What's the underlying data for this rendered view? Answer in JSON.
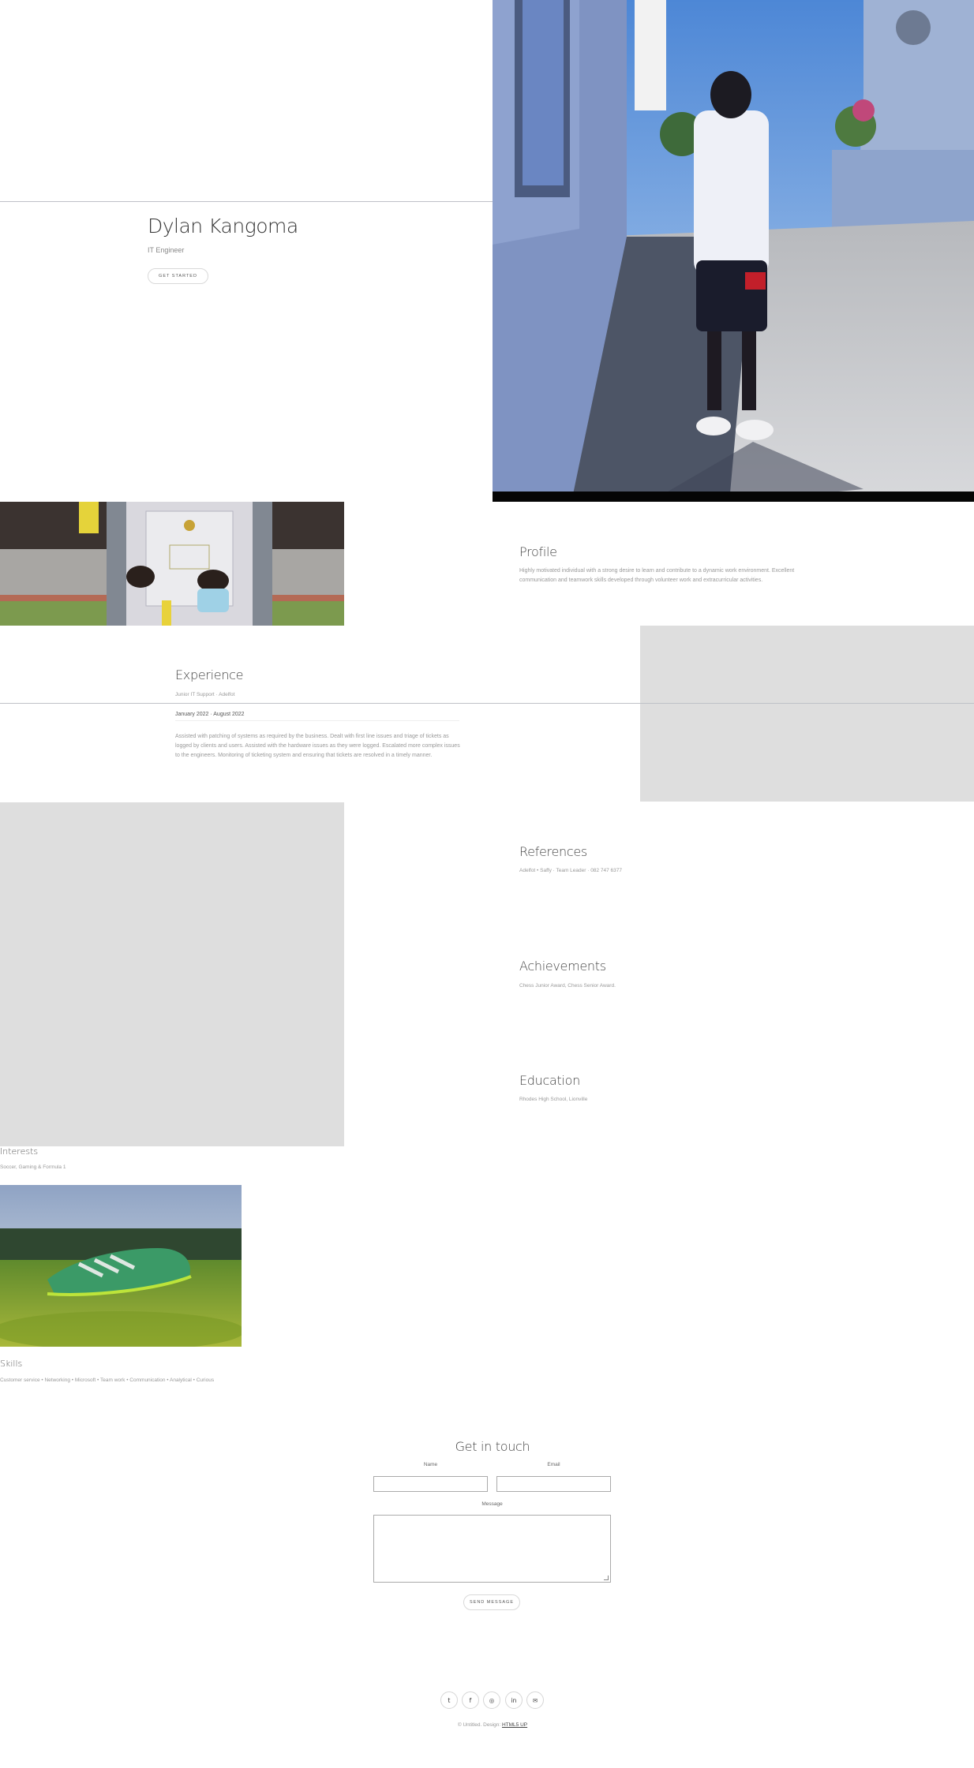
{
  "hero": {
    "name": "Dylan Kangoma",
    "role": "IT Engineer",
    "cta": "GET STARTED"
  },
  "profile": {
    "title": "Profile",
    "text": "Highly motivated individual with a strong desire to learn and contribute to a dynamic work environment. Excellent communication and teamwork skills developed through volunteer work and extracurricular activities."
  },
  "experience": {
    "title": "Experience",
    "role": "Junior IT Support · Adelfot",
    "dates": "January 2022 · August 2022",
    "text": "Assisted with patching of systems as required by the business. Dealt with first line issues and triage of tickets as logged by clients and users. Assisted with the hardware issues as they were logged. Escalated more complex issues to the engineers. Monitoring of ticketing system and ensuring that tickets are resolved in a timely manner."
  },
  "references": {
    "title": "References",
    "text": "Adelfot • Saffy · Team Leader · 082 747 6377"
  },
  "achievements": {
    "title": "Achievements",
    "text": "Chess Junior Award, Chess Senior Award."
  },
  "education": {
    "title": "Education",
    "text": "Rhodes High School, Lionville"
  },
  "interests": {
    "title": "Interests",
    "text": "Soccer, Gaming & Formula 1"
  },
  "skills": {
    "title": "Skills",
    "text": "Customer service • Networking • Microsoft • Team work • Communication • Analytical • Curious"
  },
  "contact": {
    "title": "Get in touch",
    "name_label": "Name",
    "email_label": "Email",
    "message_label": "Message",
    "send": "SEND MESSAGE"
  },
  "social": [
    {
      "icon": "twitter-icon",
      "glyph": "t"
    },
    {
      "icon": "facebook-icon",
      "glyph": "f"
    },
    {
      "icon": "instagram-icon",
      "glyph": "◎"
    },
    {
      "icon": "linkedin-icon",
      "glyph": "in"
    },
    {
      "icon": "email-icon",
      "glyph": "✉"
    }
  ],
  "footer": {
    "copyright": "© Untitled. Design: ",
    "design_link": "HTML5 UP"
  },
  "colors": {
    "accent_gray": "#dedede",
    "line": "#bfc1c8"
  }
}
